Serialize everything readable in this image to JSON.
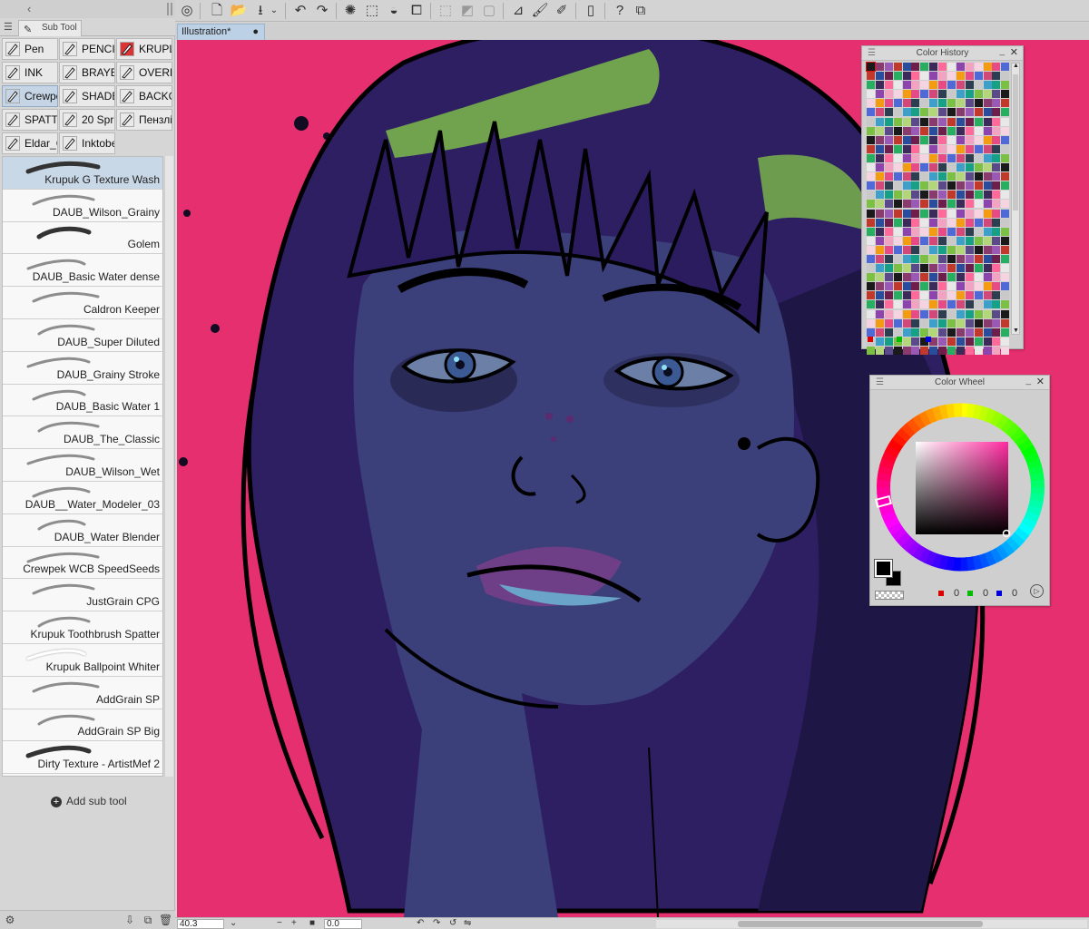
{
  "left_panel": {
    "tab_title": "Sub Tool",
    "tool_buttons": [
      {
        "label": "Pen",
        "selected": false,
        "red": false
      },
      {
        "label": "PENCI",
        "selected": false,
        "red": false
      },
      {
        "label": "KRUPL",
        "selected": false,
        "red": true
      },
      {
        "label": "INK",
        "selected": false,
        "red": false
      },
      {
        "label": "BRAYE",
        "selected": false,
        "red": false
      },
      {
        "label": "OVERL",
        "selected": false,
        "red": false
      },
      {
        "label": "Crewpe",
        "selected": true,
        "red": false
      },
      {
        "label": "SHADE",
        "selected": false,
        "red": false
      },
      {
        "label": "BACKG",
        "selected": false,
        "red": false
      },
      {
        "label": "SPATT",
        "selected": false,
        "red": false
      },
      {
        "label": "20 Spr",
        "selected": false,
        "red": false
      },
      {
        "label": "Пензлі",
        "selected": false,
        "red": false
      },
      {
        "label": "Eldar_C",
        "selected": false,
        "red": false
      },
      {
        "label": "Inktobe",
        "selected": false,
        "red": false
      }
    ],
    "brushes": [
      "Krupuk G Texture Wash",
      "DAUB_Wilson_Grainy",
      "Golem",
      "DAUB_Basic Water dense",
      "Caldron Keeper",
      "DAUB_Super Diluted",
      "DAUB_Grainy Stroke",
      "DAUB_Basic Water 1",
      "DAUB_The_Classic",
      "DAUB_Wilson_Wet",
      "DAUB__Water_Modeler_03",
      "DAUB_Water Blender",
      "Crewpek WCB SpeedSeeds",
      "JustGrain CPG",
      "Krupuk Toothbrush Spatter",
      "Krupuk Ballpoint Whiter",
      "AddGrain SP",
      "AddGrain SP Big",
      "Dirty Texture - ArtistMef 2"
    ],
    "selected_brush": "Krupuk G Texture Wash",
    "add_sub_tool_label": "Add sub tool"
  },
  "document": {
    "tab_label": "Illustration*",
    "tab_dot": "●"
  },
  "status_bar": {
    "zoom": "40.3",
    "angle": "0.0"
  },
  "color_history": {
    "title": "Color History"
  },
  "color_wheel": {
    "title": "Color Wheel",
    "r": "0",
    "g": "0",
    "b": "0",
    "foreground_color": "#000000",
    "background_color": "#000000"
  },
  "colors": {
    "canvas_bg": "#e62f6e",
    "selection": "#c9d8e7",
    "hair": "#2e1f63",
    "skin": "#3b3f7a",
    "highlight_green": "#7dbb4a"
  },
  "icons": {
    "toolbar": [
      "app-logo-icon",
      "new-file-icon",
      "open-file-icon",
      "save-icon",
      "save-menu-icon",
      "undo-icon",
      "redo-icon",
      "loading-icon",
      "fill-icon",
      "transform-icon",
      "deselect-icon",
      "invert-selection-icon",
      "select-all-icon",
      "ruler-icon",
      "brush-icon",
      "pen-icon",
      "device-icon",
      "help-icon",
      "companion-icon"
    ]
  }
}
